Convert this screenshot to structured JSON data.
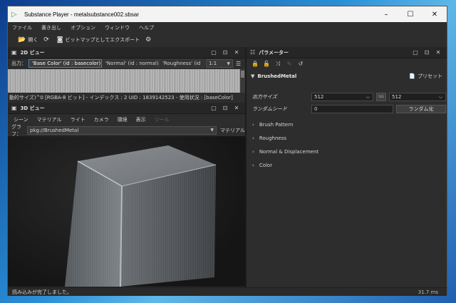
{
  "window": {
    "title": "Substance Player - metalsubstance002.sbsar",
    "controls": [
      "–",
      "☐",
      "✕"
    ]
  },
  "menu": [
    "ファイル",
    "書き出し",
    "オプション",
    "ウィンドウ",
    "ヘルプ"
  ],
  "toolbar": {
    "open_label": "開く",
    "export_label": "ビットマップとしてエクスポート"
  },
  "view2d": {
    "title": "2D ビュー",
    "output_label": "出力：",
    "tabs": [
      "'Base Color' (id : basecolor)",
      "'Normal' (id : normal)",
      "'Roughness' (id"
    ],
    "zoom_value": "1:1",
    "info": "動的サイズ)^0 [RGBA-8 ビット] - インデックス : 2 UID : 1839142523 - 使用状況 : [baseColor]"
  },
  "view3d": {
    "title": "3D ビュー",
    "menu": [
      "シーン",
      "マテリアル",
      "ライト",
      "カメラ",
      "環境",
      "表示",
      "ツール"
    ],
    "graph_label": "グラフ：",
    "graph_value": "pkg://BrushedMetal",
    "material_button": "マテリアル"
  },
  "parameters": {
    "title": "パラメーター",
    "graph_name": "BrushedMetal",
    "preset_label": "プリセット",
    "output_size_label": "出力サイズ",
    "output_size_w": "512",
    "output_size_h": "512",
    "link_label": "GG",
    "random_seed_label": "ランダムシード",
    "random_seed_value": "0",
    "randomize_label": "ランダム化",
    "groups": [
      "Brush Pattern",
      "Roughness",
      "Normal & Displacement",
      "Color"
    ]
  },
  "status": {
    "message": "読み込みが完了しました。",
    "time": "31.7 ms"
  },
  "colors": {
    "accent": "#4b7fbd",
    "title_icon": "#3fa535"
  }
}
